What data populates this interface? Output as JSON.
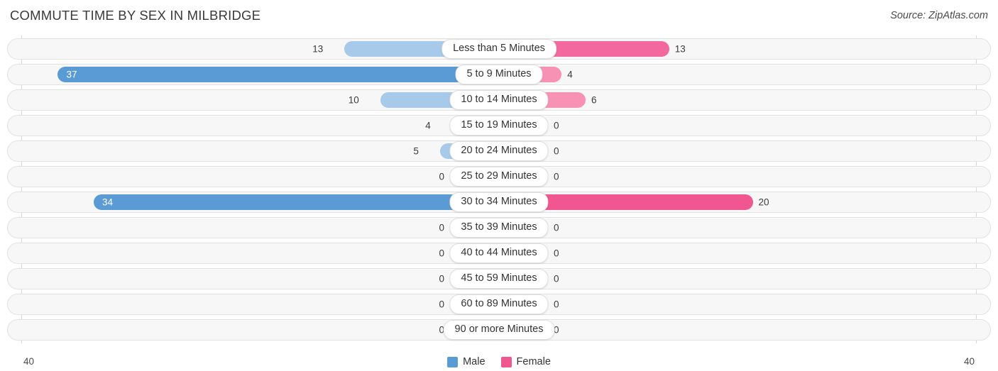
{
  "header": {
    "title": "COMMUTE TIME BY SEX IN MILBRIDGE",
    "source": "Source: ZipAtlas.com"
  },
  "axis": {
    "left_max_label": "40",
    "right_max_label": "40"
  },
  "legend": {
    "items": [
      {
        "label": "Male",
        "color": "#5b9bd5",
        "name": "legend-male"
      },
      {
        "label": "Female",
        "color": "#f0568f",
        "name": "legend-female"
      }
    ]
  },
  "chart_data": {
    "type": "bar",
    "title": "COMMUTE TIME BY SEX IN MILBRIDGE",
    "subtitle": "Source: ZipAtlas.com",
    "orientation": "horizontal-diverging",
    "xlabel": "",
    "ylabel": "",
    "axis_max": 40,
    "xlim": [
      -40,
      40
    ],
    "grid": true,
    "legend_position": "bottom-center",
    "categories": [
      "Less than 5 Minutes",
      "5 to 9 Minutes",
      "10 to 14 Minutes",
      "15 to 19 Minutes",
      "20 to 24 Minutes",
      "25 to 29 Minutes",
      "30 to 34 Minutes",
      "35 to 39 Minutes",
      "40 to 44 Minutes",
      "45 to 59 Minutes",
      "60 to 89 Minutes",
      "90 or more Minutes"
    ],
    "series": [
      {
        "name": "Male",
        "color": "#5b9bd5",
        "side": "left",
        "values": [
          13,
          37,
          10,
          4,
          5,
          0,
          34,
          0,
          0,
          0,
          0,
          0
        ],
        "labels": [
          "13",
          "37",
          "10",
          "4",
          "5",
          "0",
          "34",
          "0",
          "0",
          "0",
          "0",
          "0"
        ]
      },
      {
        "name": "Female",
        "color": "#f0568f",
        "side": "right",
        "values": [
          13,
          4,
          6,
          0,
          0,
          0,
          20,
          0,
          0,
          0,
          0,
          0
        ],
        "labels": [
          "13",
          "4",
          "6",
          "0",
          "0",
          "0",
          "20",
          "0",
          "0",
          "0",
          "0",
          "0"
        ]
      }
    ]
  }
}
